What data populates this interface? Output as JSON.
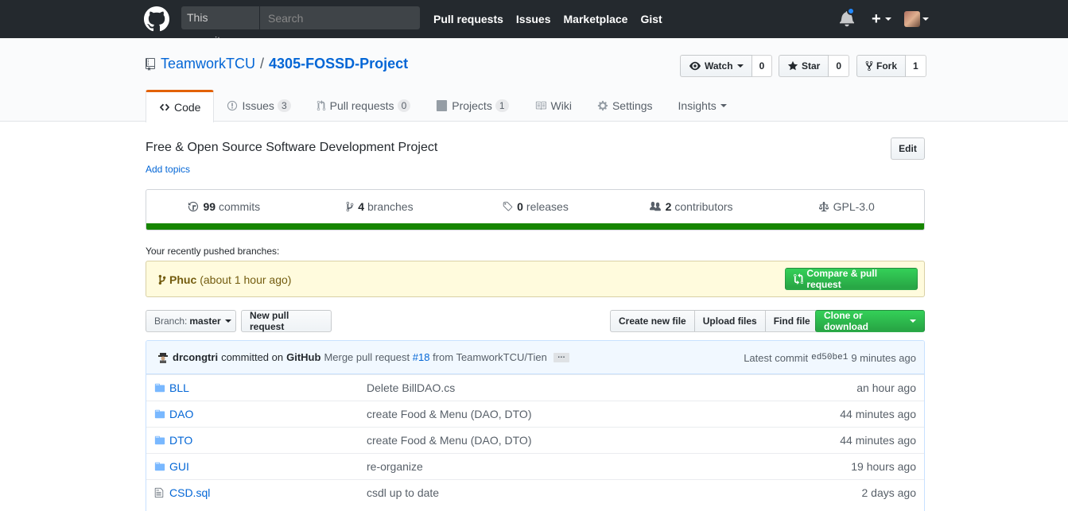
{
  "header": {
    "search_scope": "This repository",
    "search_placeholder": "Search",
    "nav": [
      "Pull requests",
      "Issues",
      "Marketplace",
      "Gist"
    ],
    "plus": "+"
  },
  "repo": {
    "owner": "TeamworkTCU",
    "separator": "/",
    "name": "4305-FOSSD-Project",
    "watch_label": "Watch",
    "watch_count": "0",
    "star_label": "Star",
    "star_count": "0",
    "fork_label": "Fork",
    "fork_count": "1"
  },
  "tabs": [
    {
      "label": "Code",
      "counter": ""
    },
    {
      "label": "Issues",
      "counter": "3"
    },
    {
      "label": "Pull requests",
      "counter": "0"
    },
    {
      "label": "Projects",
      "counter": "1"
    },
    {
      "label": "Wiki",
      "counter": ""
    },
    {
      "label": "Settings",
      "counter": ""
    },
    {
      "label": "Insights",
      "counter": ""
    }
  ],
  "description": "Free & Open Source Software Development Project",
  "add_topics": "Add topics",
  "edit_label": "Edit",
  "summary": {
    "commits_num": "99",
    "commits_label": "commits",
    "branches_num": "4",
    "branches_label": "branches",
    "releases_num": "0",
    "releases_label": "releases",
    "contributors_num": "2",
    "contributors_label": "contributors",
    "license": "GPL-3.0",
    "language_color": "#178600"
  },
  "recent": {
    "label": "Your recently pushed branches:",
    "branch": "Phuc",
    "time": "(about 1 hour ago)",
    "compare_label": "Compare & pull request"
  },
  "filenav": {
    "branch_prefix": "Branch:",
    "branch_name": "master",
    "new_pr": "New pull request",
    "create_file": "Create new file",
    "upload_files": "Upload files",
    "find_file": "Find file",
    "clone": "Clone or download"
  },
  "commit": {
    "author": "drcongtri",
    "committed_on": "committed on",
    "platform": "GitHub",
    "msg_prefix": "Merge pull request",
    "pr_link": "#18",
    "msg_suffix": "from TeamworkTCU/Tien",
    "ellipsis": "…",
    "latest_label": "Latest commit",
    "sha": "ed50be1",
    "time": "9 minutes ago"
  },
  "files": [
    {
      "type": "dir",
      "name": "BLL",
      "message": "Delete BillDAO.cs",
      "age": "an hour ago"
    },
    {
      "type": "dir",
      "name": "DAO",
      "message": "create Food & Menu (DAO, DTO)",
      "age": "44 minutes ago"
    },
    {
      "type": "dir",
      "name": "DTO",
      "message": "create Food & Menu (DAO, DTO)",
      "age": "44 minutes ago"
    },
    {
      "type": "dir",
      "name": "GUI",
      "message": "re-organize",
      "age": "19 hours ago"
    },
    {
      "type": "file",
      "name": "CSD.sql",
      "message": "csdl up to date",
      "age": "2 days ago"
    }
  ]
}
